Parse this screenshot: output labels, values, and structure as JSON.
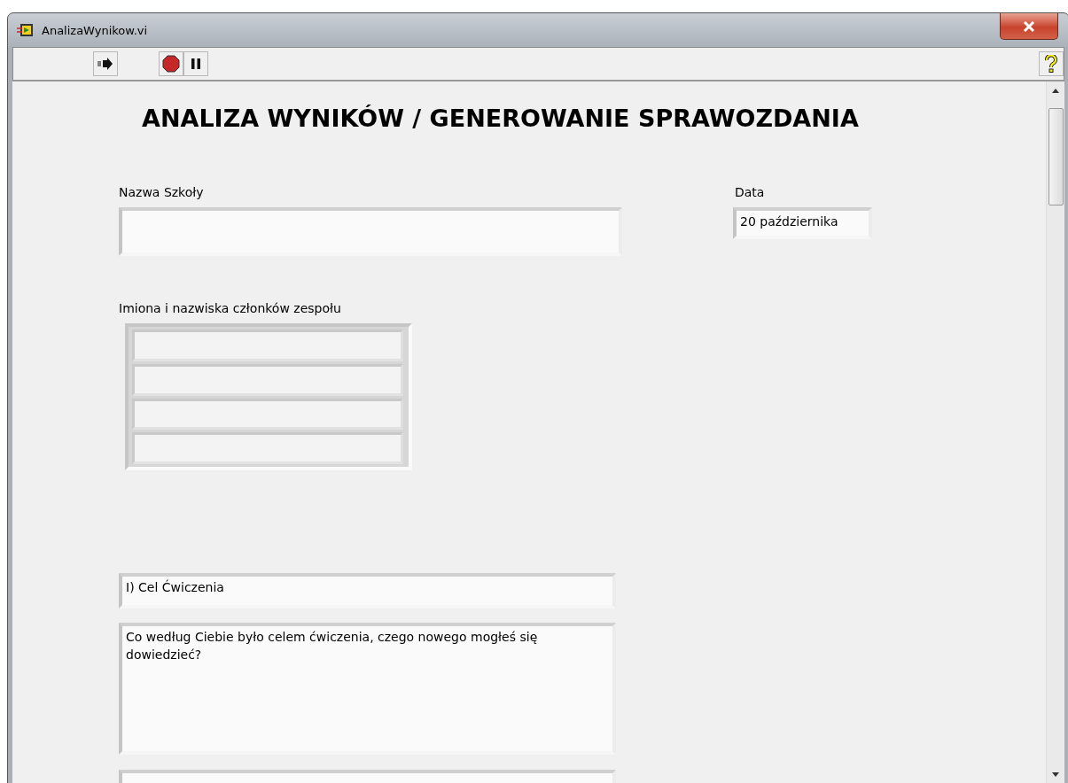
{
  "window": {
    "title": "AnalizaWynikow.vi"
  },
  "heading": "ANALIZA WYNIKÓW / GENEROWANIE SPRAWOZDANIA",
  "school_name": {
    "label": "Nazwa Szkoły"
  },
  "date": {
    "label": "Data",
    "value": "20 października"
  },
  "team_members": {
    "label": "Imiona i nazwiska członków zespołu"
  },
  "section": {
    "title": "I) Cel Ćwiczenia",
    "question": "Co według Ciebie było celem ćwiczenia, czego nowego mogłeś się dowiedzieć?"
  }
}
